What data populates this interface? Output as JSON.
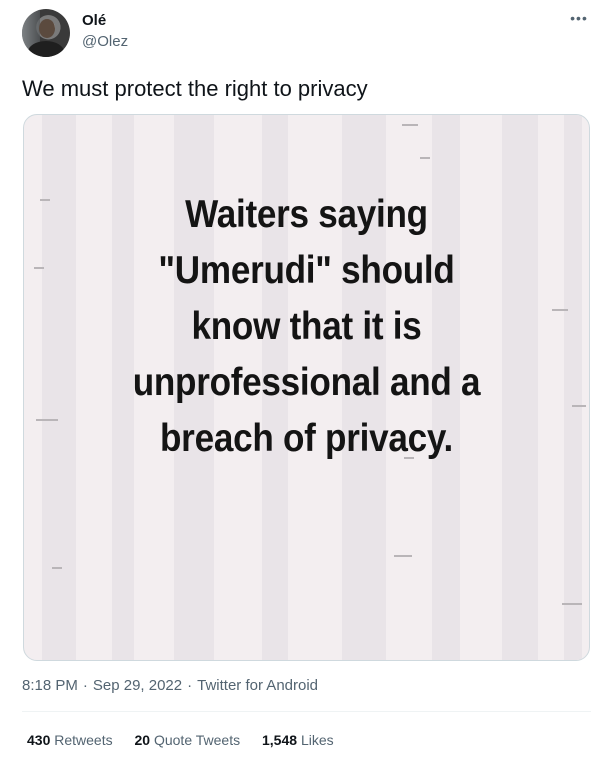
{
  "author": {
    "name": "Olé",
    "handle": "@Olez"
  },
  "more_icon": "more-horizontal-icon",
  "tweet_text": "We must protect the right to privacy",
  "media": {
    "caption_lines": [
      "Waiters saying",
      "\"Umerudi\" should",
      "know that it is",
      "unprofessional and a",
      "breach of privacy."
    ]
  },
  "meta": {
    "time": "8:18 PM",
    "date": "Sep 29, 2022",
    "source": "Twitter for Android"
  },
  "stats": {
    "retweets_count": "430",
    "retweets_label": "Retweets",
    "quotes_count": "20",
    "quotes_label": "Quote Tweets",
    "likes_count": "1,548",
    "likes_label": "Likes"
  },
  "colors": {
    "secondary_text": "#536471",
    "primary_text": "#0f1419",
    "border": "#cfd9de",
    "image_bg": "#f3eef0"
  }
}
